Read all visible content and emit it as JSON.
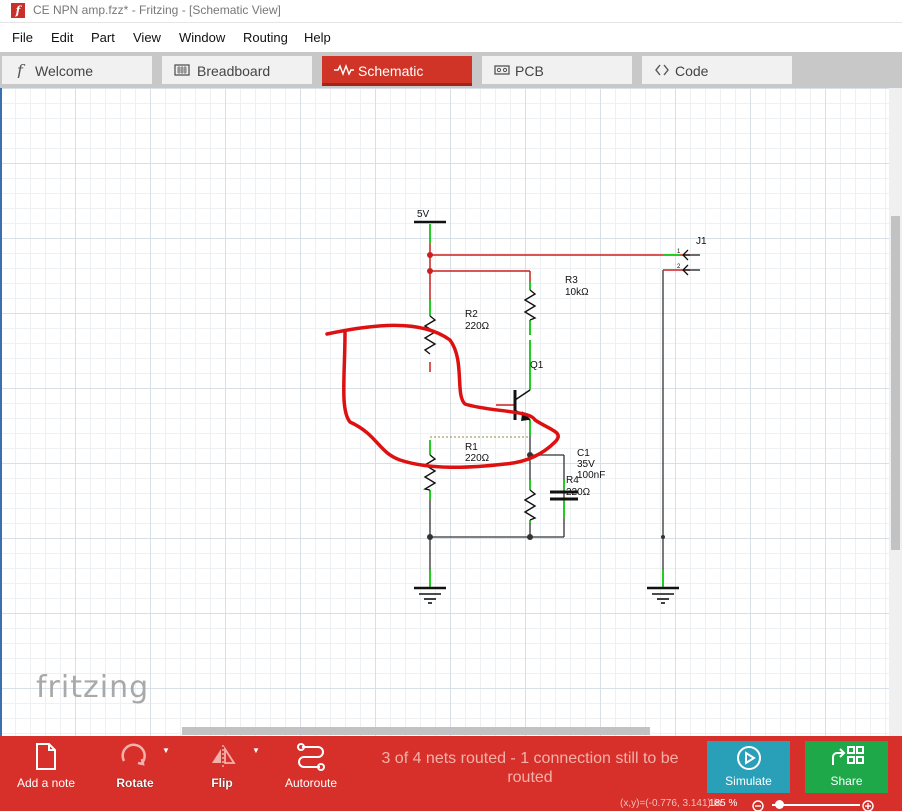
{
  "window": {
    "title": "CE NPN amp.fzz* - Fritzing - [Schematic View]",
    "logo_letter": "f"
  },
  "menu": [
    "File",
    "Edit",
    "Part",
    "View",
    "Window",
    "Routing",
    "Help"
  ],
  "tabs": [
    {
      "label": "Welcome",
      "icon": "fritzing-f-icon"
    },
    {
      "label": "Breadboard",
      "icon": "breadboard-icon"
    },
    {
      "label": "Schematic",
      "icon": "resistor-icon",
      "active": true
    },
    {
      "label": "PCB",
      "icon": "pcb-icon"
    },
    {
      "label": "Code",
      "icon": "code-icon"
    }
  ],
  "schematic": {
    "labels": {
      "v5": "5V",
      "j1": "J1",
      "j1_pin1": "1",
      "j1_pin2": "2",
      "r3_name": "R3",
      "r3_value": "10kΩ",
      "r2_name": "R2",
      "r2_value": "220Ω",
      "q1_name": "Q1",
      "r1_name": "R1",
      "r1_value": "220Ω",
      "c1_name": "C1",
      "c1_voltage": "35V",
      "c1_value": "100nF",
      "r4_name": "R4",
      "r4_value": "220Ω"
    },
    "colors": {
      "wire_routed": "#333333",
      "wire_power": "#cc1f1f",
      "pin_ok": "#22cc22",
      "annotation": "#dd1111"
    }
  },
  "watermark": "fritzing",
  "toolbar": {
    "add_note": "Add a note",
    "rotate": "Rotate",
    "flip": "Flip",
    "autoroute": "Autoroute",
    "routing_status": "3 of 4 nets routed - 1 connection still to be routed",
    "simulate": "Simulate",
    "share": "Share"
  },
  "statusbar": {
    "coordinates": "(x,y)=(-0.776, 3.141) in",
    "zoom": "185 %"
  },
  "colors": {
    "accent": "#d7302a",
    "simulate": "#2a9fb8",
    "share": "#1fa84a"
  }
}
